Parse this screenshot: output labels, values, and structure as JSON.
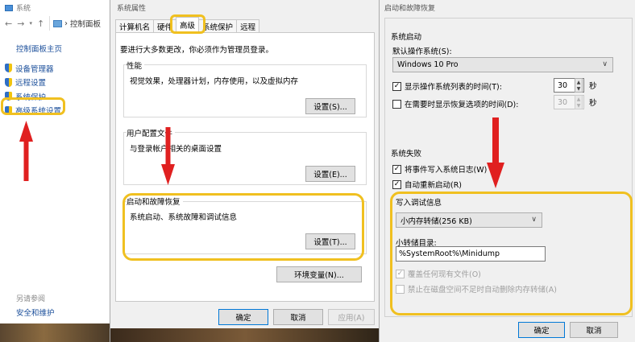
{
  "control_panel": {
    "window_title": "系统",
    "breadcrumb": "控制面板",
    "home_link": "控制面板主页",
    "links": [
      "设备管理器",
      "远程设置",
      "系统保护",
      "高级系统设置"
    ],
    "see_also": "另请参阅",
    "see_also_links": [
      "安全和维护"
    ]
  },
  "system_properties": {
    "window_title": "系统属性",
    "tabs": [
      "计算机名",
      "硬件",
      "高级",
      "系统保护",
      "远程"
    ],
    "active_tab": "高级",
    "admin_note": "要进行大多数更改，你必须作为管理员登录。",
    "groups": [
      {
        "label": "性能",
        "desc": "视觉效果，处理器计划，内存使用，以及虚拟内存",
        "button": "设置(S)..."
      },
      {
        "label": "用户配置文件",
        "desc": "与登录帐户相关的桌面设置",
        "button": "设置(E)..."
      },
      {
        "label": "启动和故障恢复",
        "desc": "系统启动、系统故障和调试信息",
        "button": "设置(T)..."
      }
    ],
    "env_button": "环境变量(N)...",
    "ok": "确定",
    "cancel": "取消",
    "apply": "应用(A)"
  },
  "startup_recovery": {
    "window_title": "启动和故障恢复",
    "startup_section": "系统启动",
    "default_os_label": "默认操作系统(S):",
    "default_os_value": "Windows 10 Pro",
    "show_os_list_label": "显示操作系统列表的时间(T):",
    "show_os_list_checked": true,
    "show_os_list_value": "30",
    "show_recovery_label": "在需要时显示恢复选项的时间(D):",
    "show_recovery_checked": false,
    "show_recovery_value": "30",
    "seconds_unit": "秒",
    "failure_section": "系统失败",
    "write_event_label": "将事件写入系统日志(W)",
    "write_event_checked": true,
    "auto_restart_label": "自动重新启动(R)",
    "auto_restart_checked": true,
    "debug_section": "写入调试信息",
    "debug_type_value": "小内存转储(256 KB)",
    "dump_dir_label": "小转储目录:",
    "dump_dir_value": "%SystemRoot%\\Minidump",
    "overwrite_label": "覆盖任何现有文件(O)",
    "overwrite_checked": true,
    "disable_autodelete_label": "禁止在磁盘空间不足时自动删除内存转储(A)",
    "disable_autodelete_checked": false,
    "ok": "确定",
    "cancel": "取消"
  },
  "colors": {
    "highlight": "#f0c020",
    "arrow": "#e02020",
    "link": "#1a4e9a"
  }
}
